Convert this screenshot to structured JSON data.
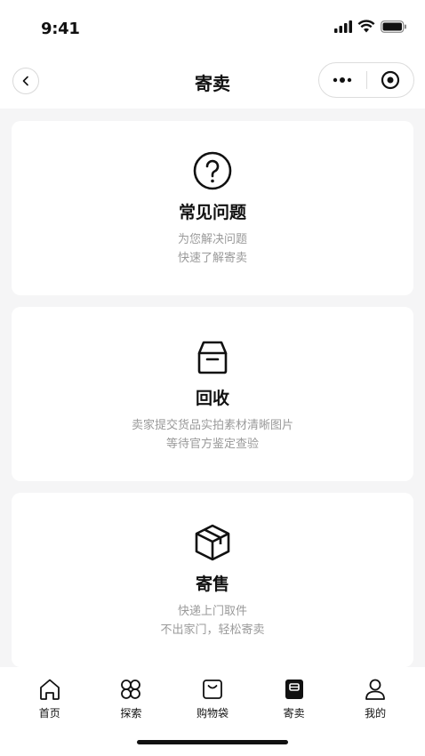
{
  "status_bar": {
    "time": "9:41"
  },
  "nav": {
    "title": "寄卖"
  },
  "cards": [
    {
      "title": "常见问题",
      "desc_line1": "为您解决问题",
      "desc_line2": "快速了解寄卖",
      "icon": "question-circle-icon"
    },
    {
      "title": "回收",
      "desc_line1": "卖家提交货品实拍素材清晰图片",
      "desc_line2": "等待官方鉴定查验",
      "icon": "box-open-icon"
    },
    {
      "title": "寄售",
      "desc_line1": "快递上门取件",
      "desc_line2": "不出家门，轻松寄卖",
      "icon": "package-cube-icon"
    }
  ],
  "tab_bar": {
    "items": [
      {
        "label": "首页",
        "icon": "home-icon"
      },
      {
        "label": "探索",
        "icon": "explore-icon"
      },
      {
        "label": "购物袋",
        "icon": "shopping-bag-icon"
      },
      {
        "label": "寄卖",
        "icon": "consign-icon",
        "active": true
      },
      {
        "label": "我的",
        "icon": "profile-icon"
      }
    ]
  },
  "colors": {
    "background": "#f5f5f6",
    "text": "#111111",
    "muted": "#9a9a9a"
  }
}
